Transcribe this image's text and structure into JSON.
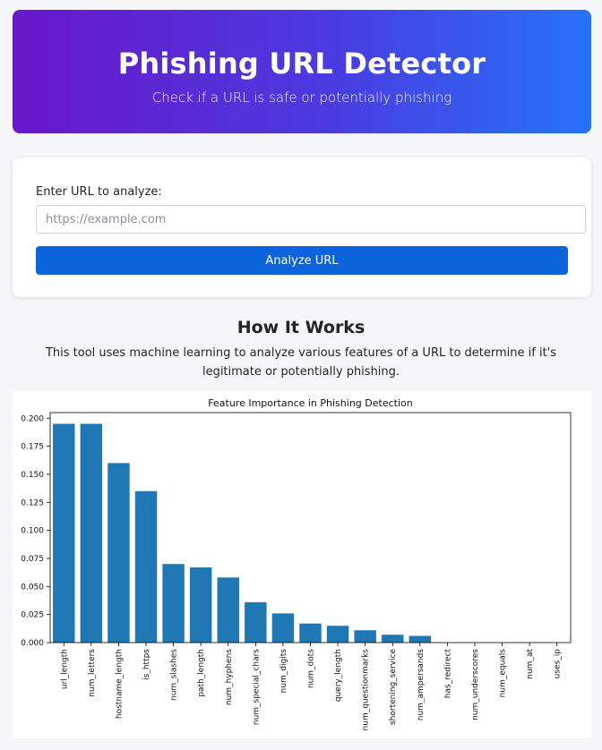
{
  "header": {
    "title": "Phishing URL Detector",
    "subtitle": "Check if a URL is safe or potentially phishing"
  },
  "form": {
    "label": "Enter URL to analyze:",
    "placeholder": "https://example.com",
    "value": "",
    "button_label": "Analyze URL"
  },
  "how_it_works": {
    "title": "How It Works",
    "description": "This tool uses machine learning to analyze various features of a URL to determine if it's legitimate or potentially phishing."
  },
  "colors": {
    "header_start": "#6a17c9",
    "header_end": "#2773f7",
    "button": "#0b64dc",
    "bar": "#1f77b4"
  },
  "chart_data": {
    "type": "bar",
    "title": "Feature Importance in Phishing Detection",
    "xlabel": "",
    "ylabel": "",
    "ylim": [
      0,
      0.205
    ],
    "yticks": [
      "0.000",
      "0.025",
      "0.050",
      "0.075",
      "0.100",
      "0.125",
      "0.150",
      "0.175",
      "0.200"
    ],
    "grid": false,
    "categories": [
      "url_length",
      "num_letters",
      "hostname_length",
      "is_https",
      "num_slashes",
      "path_length",
      "num_hyphens",
      "num_special_chars",
      "num_digits",
      "num_dots",
      "query_length",
      "num_questionmarks",
      "shortening_service",
      "num_ampersands",
      "has_redirect",
      "num_underscores",
      "num_equals",
      "num_at",
      "uses_ip"
    ],
    "values": [
      0.195,
      0.195,
      0.16,
      0.135,
      0.07,
      0.067,
      0.058,
      0.036,
      0.026,
      0.017,
      0.015,
      0.011,
      0.007,
      0.006,
      0.0,
      0.0,
      0.0,
      0.0,
      0.0
    ]
  }
}
